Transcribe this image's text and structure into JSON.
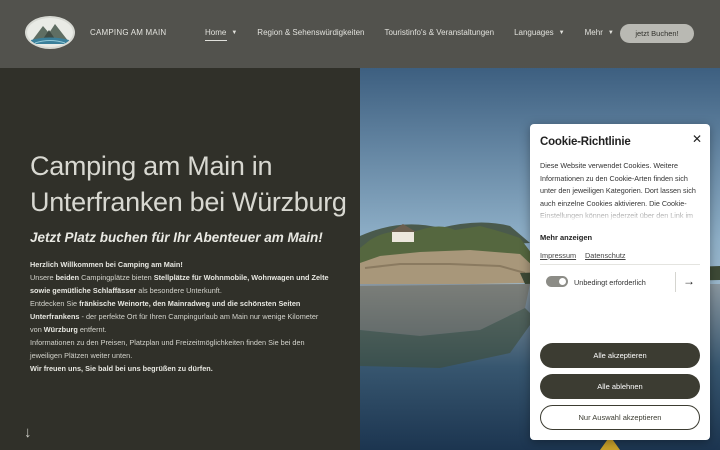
{
  "header": {
    "brand": "CAMPING AM MAIN",
    "nav": [
      {
        "label": "Home",
        "chevron": true
      },
      {
        "label": "Region & Sehenswürdigkeiten",
        "chevron": false
      },
      {
        "label": "Touristinfo's & Veranstaltungen",
        "chevron": false
      },
      {
        "label": "Languages",
        "chevron": true
      },
      {
        "label": "Mehr",
        "chevron": true
      }
    ],
    "book_label": "jetzt Buchen!"
  },
  "hero": {
    "title_line1": "Camping am Main in",
    "title_line2": "Unterfranken bei Würzburg",
    "subtitle": "Jetzt Platz buchen für Ihr Abenteuer am Main!",
    "p1": "Herzlich Willkommen bei Camping am Main!",
    "p2a": "Unsere ",
    "p2b": "beiden",
    "p2c": " Campingplätze bieten ",
    "p2d": "Stellplätze für Wohnmobile, Wohnwagen und Zelte sowie gemütliche Schlaffässer",
    "p2e": " als besondere Unterkunft.",
    "p3a": "Entdecken Sie ",
    "p3b": "fränkische Weinorte, den Mainradweg und die schönsten Seiten Unterfrankens",
    "p3c": " - der perfekte Ort für Ihren Campingurlaub am Main nur wenige Kilometer von ",
    "p3d": "Würzburg",
    "p3e": " entfernt.",
    "p4": "Informationen zu den Preisen, Platzplan und Freizeitmöglichkeiten finden Sie bei den jeweiligen Plätzen weiter unten.",
    "p5": "Wir freuen uns, Sie bald bei uns begrüßen zu dürfen.",
    "down_arrow": "↓"
  },
  "cookie": {
    "title": "Cookie-Richtlinie",
    "close": "✕",
    "text": "Diese Website verwendet Cookies. Weitere Informationen zu den Cookie-Arten finden sich unter den jeweiligen Kategorien. Dort lassen sich auch einzelne Cookies aktivieren. Die Cookie-Einstellungen können jederzeit über den Link im",
    "more": "Mehr anzeigen",
    "impressum": "Impressum",
    "datenschutz": "Datenschutz",
    "toggle_label": "Unbedingt erforderlich",
    "accept_all": "Alle akzeptieren",
    "reject_all": "Alle ablehnen",
    "accept_selection": "Nur Auswahl akzeptieren"
  },
  "icons": {
    "arrow_right": "→"
  },
  "colors": {
    "header_bg": "#52524d",
    "panel_bg": "#303029",
    "button_dark": "#3c3c32"
  }
}
